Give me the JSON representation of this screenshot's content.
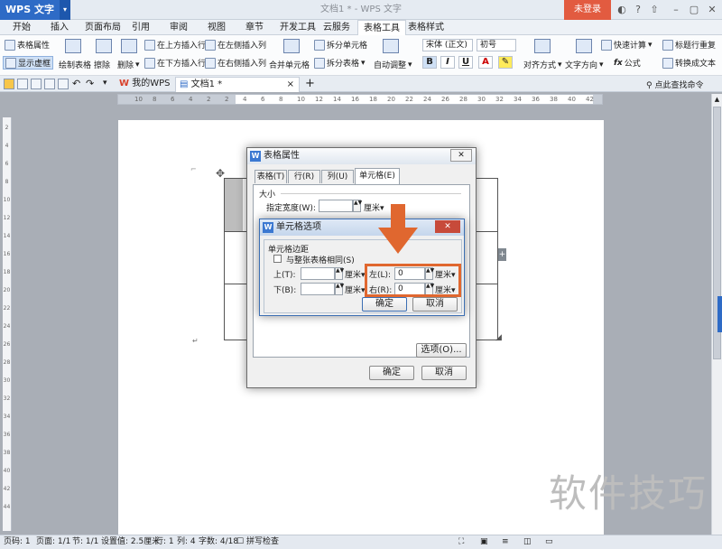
{
  "titlebar": {
    "app_name": "WPS 文字",
    "doc_title": "文档1 * - WPS 文字",
    "login": "未登录"
  },
  "menu": [
    "开始",
    "插入",
    "页面布局",
    "引用",
    "审阅",
    "视图",
    "章节",
    "开发工具",
    "云服务",
    "表格工具",
    "表格样式"
  ],
  "ribbon": {
    "table_props": "表格属性",
    "show_gridlines": "显示虚框",
    "draw_table": "绘制表格",
    "erase": "擦除",
    "delete": "删除",
    "insert_above": "在上方插入行",
    "insert_below": "在下方插入行",
    "insert_left": "在左侧插入列",
    "insert_right": "在右侧插入列",
    "merge_cells": "合并单元格",
    "split_cells": "拆分单元格",
    "split_table": "拆分表格",
    "auto_fit": "自动调整",
    "font_name": "宋体 (正文)",
    "font_size": "初号",
    "bold": "B",
    "italic": "I",
    "underline": "U",
    "font_color": "A",
    "align": "对齐方式",
    "text_dir": "文字方向",
    "formula": "公式",
    "fx": "fx",
    "quick_calc": "快速计算",
    "repeat_header": "标题行重复",
    "convert_text": "转换成文本"
  },
  "tabs": {
    "my_wps": "我的WPS",
    "doc": "文档1 *",
    "search": "点此查找命令"
  },
  "ruler_numbers": [
    "10",
    "8",
    "6",
    "4",
    "2",
    "2",
    "4",
    "6",
    "8",
    "10",
    "12",
    "14",
    "16",
    "18",
    "20",
    "22",
    "24",
    "26",
    "28",
    "30",
    "32",
    "34",
    "36",
    "38",
    "40",
    "42"
  ],
  "vruler_numbers": [
    "2",
    "4",
    "6",
    "8",
    "10",
    "12",
    "14",
    "16",
    "18",
    "20",
    "22",
    "24",
    "26",
    "28",
    "30",
    "32",
    "34",
    "36",
    "38",
    "40",
    "42",
    "44"
  ],
  "table_dialog": {
    "title": "表格属性",
    "tabs": [
      "表格(T)",
      "行(R)",
      "列(U)",
      "单元格(E)"
    ],
    "section_size": "大小",
    "width_label": "指定宽度(W):",
    "width_unit": "厘米",
    "options_btn": "选项(O)...",
    "ok": "确定",
    "cancel": "取消"
  },
  "cell_dialog": {
    "title": "单元格选项",
    "section": "单元格边距",
    "same_as_table": "与整张表格相同(S)",
    "top_label": "上(T):",
    "bottom_label": "下(B):",
    "left_label": "左(L):",
    "right_label": "右(R):",
    "top_value": "",
    "bottom_value": "",
    "left_value": "0",
    "right_value": "0",
    "unit": "厘米",
    "ok": "确定",
    "cancel": "取消"
  },
  "status": {
    "page": "页码: 1",
    "pages": "页面: 1/1",
    "section": "节: 1/1",
    "setting": "设置值: 2.5厘米",
    "row": "行: 1",
    "col": "列: 4",
    "words": "字数: 4/18",
    "spell": "拼写检查"
  },
  "watermark": "软件技巧",
  "colors": {
    "accent": "#2e6bc6",
    "login": "#e25b40",
    "highlight": "#e0672f"
  }
}
